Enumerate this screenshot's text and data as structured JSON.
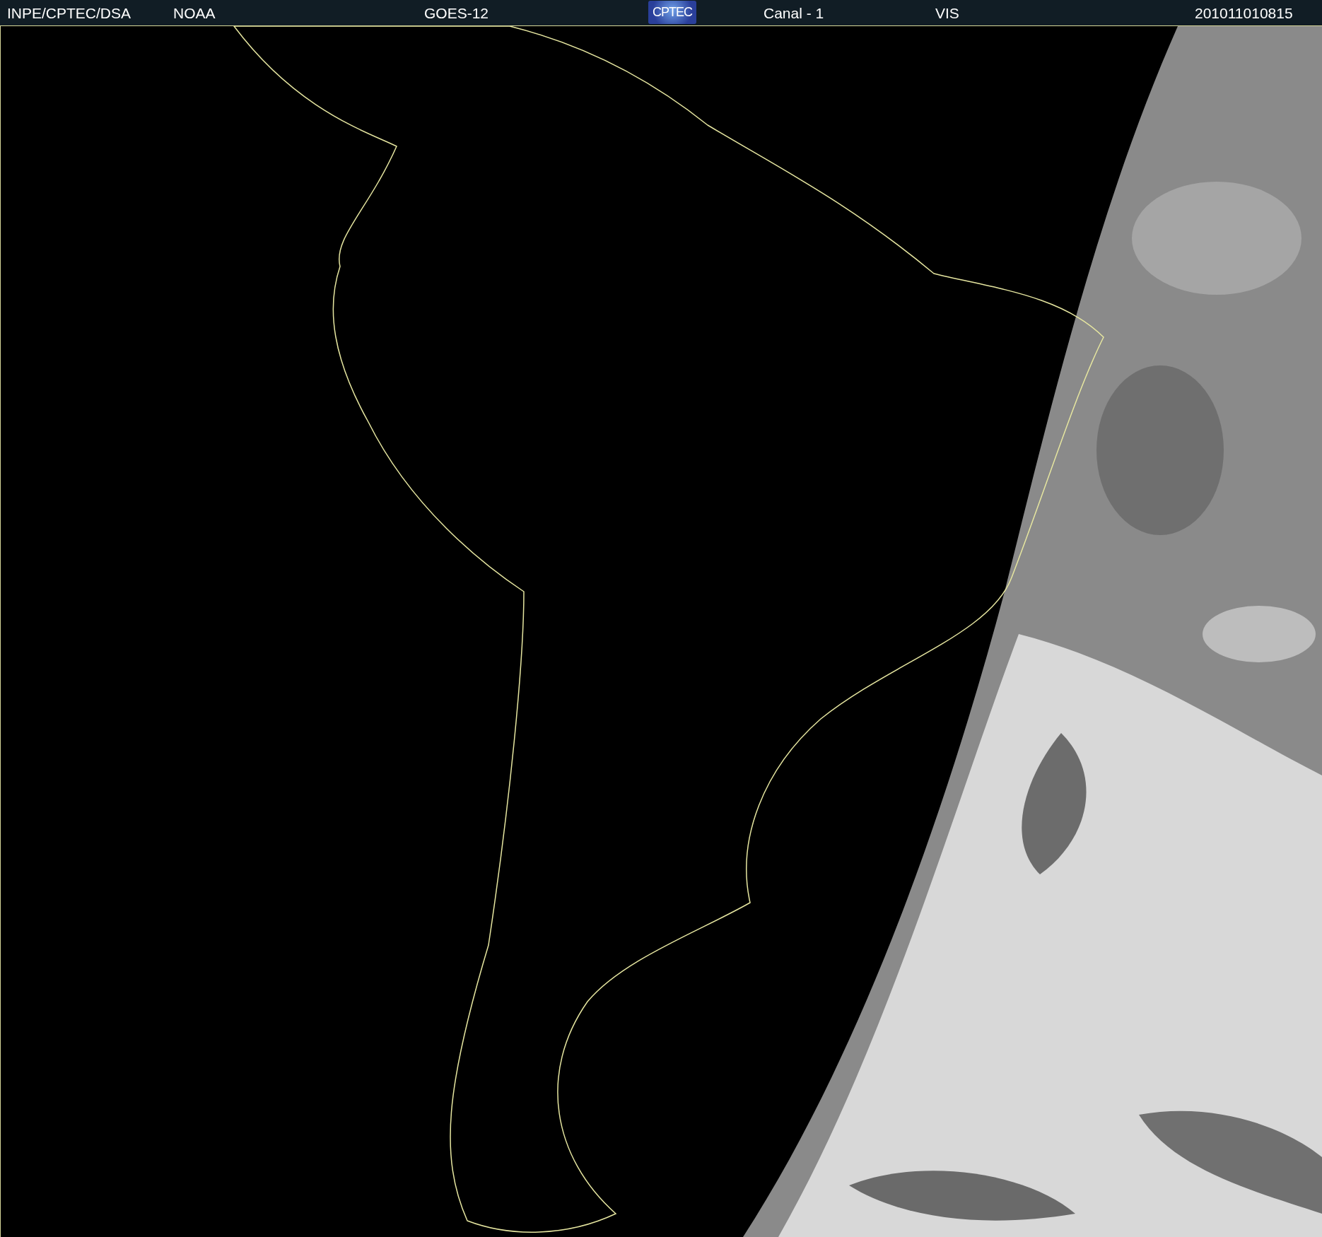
{
  "header": [
    {
      "kind": "text",
      "text": "INPE/CPTEC/DSA"
    },
    {
      "kind": "text",
      "text": "NOAA"
    },
    {
      "kind": "text",
      "text": "GOES-12"
    },
    {
      "kind": "logo",
      "text": "CPTEC"
    },
    {
      "kind": "text",
      "text": "Canal - 1"
    },
    {
      "kind": "text",
      "text": "VIS"
    },
    {
      "kind": "text",
      "text": "201011010815"
    }
  ]
}
